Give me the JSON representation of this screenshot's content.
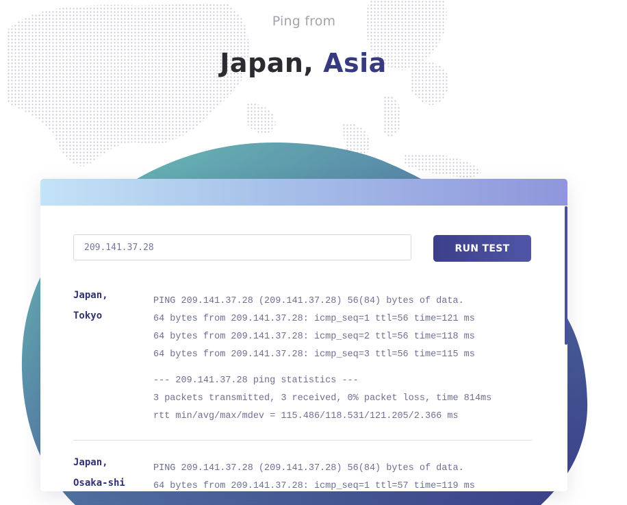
{
  "header": {
    "subtitle": "Ping from",
    "title_country": "Japan,",
    "title_region": "Asia"
  },
  "form": {
    "ip_value": "209.141.37.28",
    "run_label": "RUN TEST"
  },
  "results": [
    {
      "location_line1": "Japan,",
      "location_line2": "Tokyo",
      "lines": [
        "PING 209.141.37.28 (209.141.37.28) 56(84) bytes of data.",
        "64 bytes from 209.141.37.28: icmp_seq=1 ttl=56 time=121 ms",
        "64 bytes from 209.141.37.28: icmp_seq=2 ttl=56 time=118 ms",
        "64 bytes from 209.141.37.28: icmp_seq=3 ttl=56 time=115 ms"
      ],
      "stats": [
        "--- 209.141.37.28 ping statistics ---",
        "3 packets transmitted, 3 received, 0% packet loss, time 814ms",
        "rtt min/avg/max/mdev = 115.486/118.531/121.205/2.366 ms"
      ]
    },
    {
      "location_line1": "Japan,",
      "location_line2": "Osaka-shi",
      "lines": [
        "PING 209.141.37.28 (209.141.37.28) 56(84) bytes of data.",
        "64 bytes from 209.141.37.28: icmp_seq=1 ttl=57 time=119 ms"
      ],
      "stats": []
    }
  ],
  "colors": {
    "accent": "#363a7e",
    "button": "#3c3f88",
    "blob_start": "#6ec6b9",
    "blob_end": "#3a3f8a"
  }
}
